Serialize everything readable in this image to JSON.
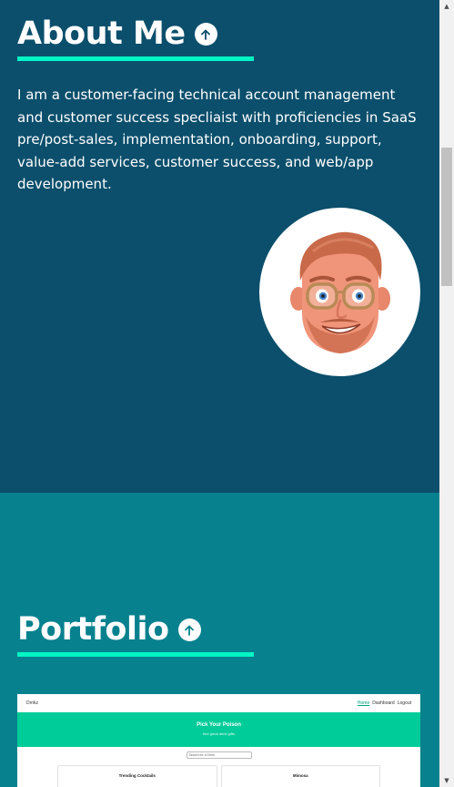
{
  "about": {
    "heading": "About Me",
    "icon": "arrow-up-circle-icon",
    "text": "I am a customer-facing technical account management and customer success specliaist with proficiencies in SaaS pre/post-sales, implementation, onboarding, support, value-add services, customer success, and web/app development.",
    "avatar_icon": "memoji-avatar-icon"
  },
  "portfolio": {
    "heading": "Portfolio",
    "icon": "arrow-up-circle-icon",
    "screenshot": {
      "brand": "Drnkz",
      "nav": [
        "Home",
        "Dashboard",
        "Logout"
      ],
      "hero_title": "Pick Your Poison",
      "hero_subtitle": "find great drink gifts",
      "search_placeholder": "Search for a Drink",
      "cards": [
        "Trending Cocktails",
        "Mimosa"
      ]
    }
  },
  "colors": {
    "about_bg": "#0b4f6c",
    "portfolio_bg": "#08818f",
    "accent": "#00f5c4",
    "screenshot_hero": "#00cc99"
  },
  "scrollbar": {
    "up_icon": "scroll-up-arrow-icon",
    "down_icon": "scroll-down-arrow-icon"
  }
}
